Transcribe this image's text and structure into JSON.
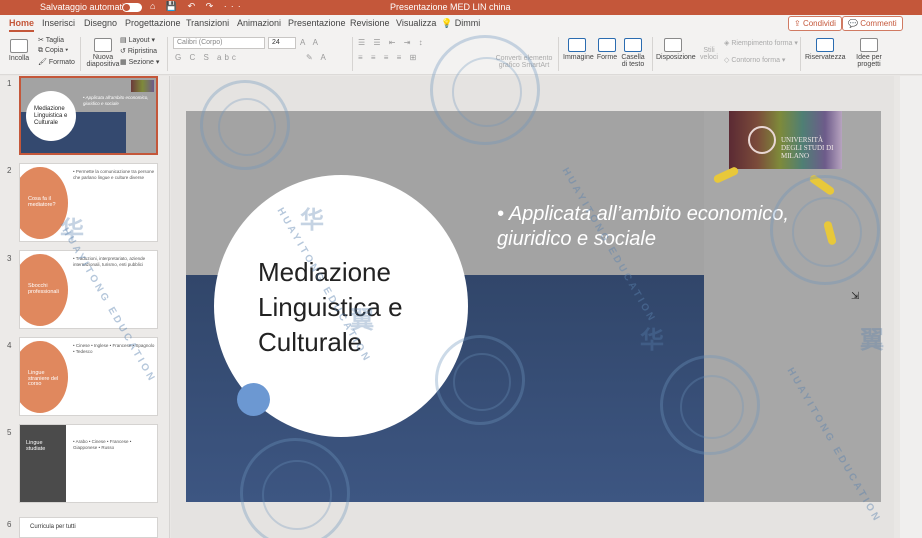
{
  "titlebar": {
    "autosave_label": "Salvataggio automatico",
    "toggle_label": "o",
    "quick_icons": "⌂ 💾 ↶ ↷ ···",
    "doc_title": "Presentazione MED LIN china"
  },
  "tabs": [
    "Home",
    "Inserisci",
    "Disegno",
    "Progettazione",
    "Transizioni",
    "Animazioni",
    "Presentazione",
    "Revisione",
    "Visualizza",
    "Dimmi"
  ],
  "share_label": "Condividi",
  "comments_label": "Commenti",
  "ribbon": {
    "paste": "Incolla",
    "cut": "Taglia",
    "copy": "Copia",
    "format": "Formato",
    "new_slide": "Nuova diapositiva",
    "layout": "Layout",
    "reset": "Ripristina",
    "section": "Sezione",
    "font_name": "Calibri (Corpo)",
    "font_size": "24",
    "smartart": "Converti elemento grafico SmartArt",
    "image": "Immagine",
    "shapes": "Forme",
    "textbox": "Casella di testo",
    "arrange": "Disposizione",
    "quick_styles": "Stili veloci",
    "shape_fill": "Riempimento forma",
    "shape_outline": "Contorno forma",
    "sensitivity": "Riservatezza",
    "designer": "Idee per progetti"
  },
  "thumbnails": [
    {
      "num": "1",
      "title": "Mediazione Linguistica e Culturale",
      "text": "• Applicata all'ambito economico, giuridico e sociale"
    },
    {
      "num": "2",
      "title": "Cosa fa il mediatore?",
      "text": "• Permette la comunicazione tra persone che parlano lingue e culture diverse"
    },
    {
      "num": "3",
      "title": "Sbocchi professionali",
      "text": "• Traduzioni, interpretariato, aziende internazionali, turismo, enti pubblici"
    },
    {
      "num": "4",
      "title": "Lingue straniere del corso",
      "text": "• Cinese • Inglese • Francese • Spagnolo • Tedesco"
    },
    {
      "num": "5",
      "title": "Lingue studiate",
      "text": "• Arabo • Cinese • Francese • Giapponese • Russo"
    },
    {
      "num": "6",
      "title": "Curricula per tutti",
      "text": ""
    }
  ],
  "slide": {
    "title": "Mediazione Linguistica e Culturale",
    "bullet": "• Applicata all’ambito economico, giuridico e sociale",
    "logo_text": "UNIVERSITÀ DEGLI STUDI DI MILANO"
  },
  "watermark": {
    "text": "HUAYITONG EDUCATION",
    "glyph": "华",
    "glyph2": "翼"
  }
}
